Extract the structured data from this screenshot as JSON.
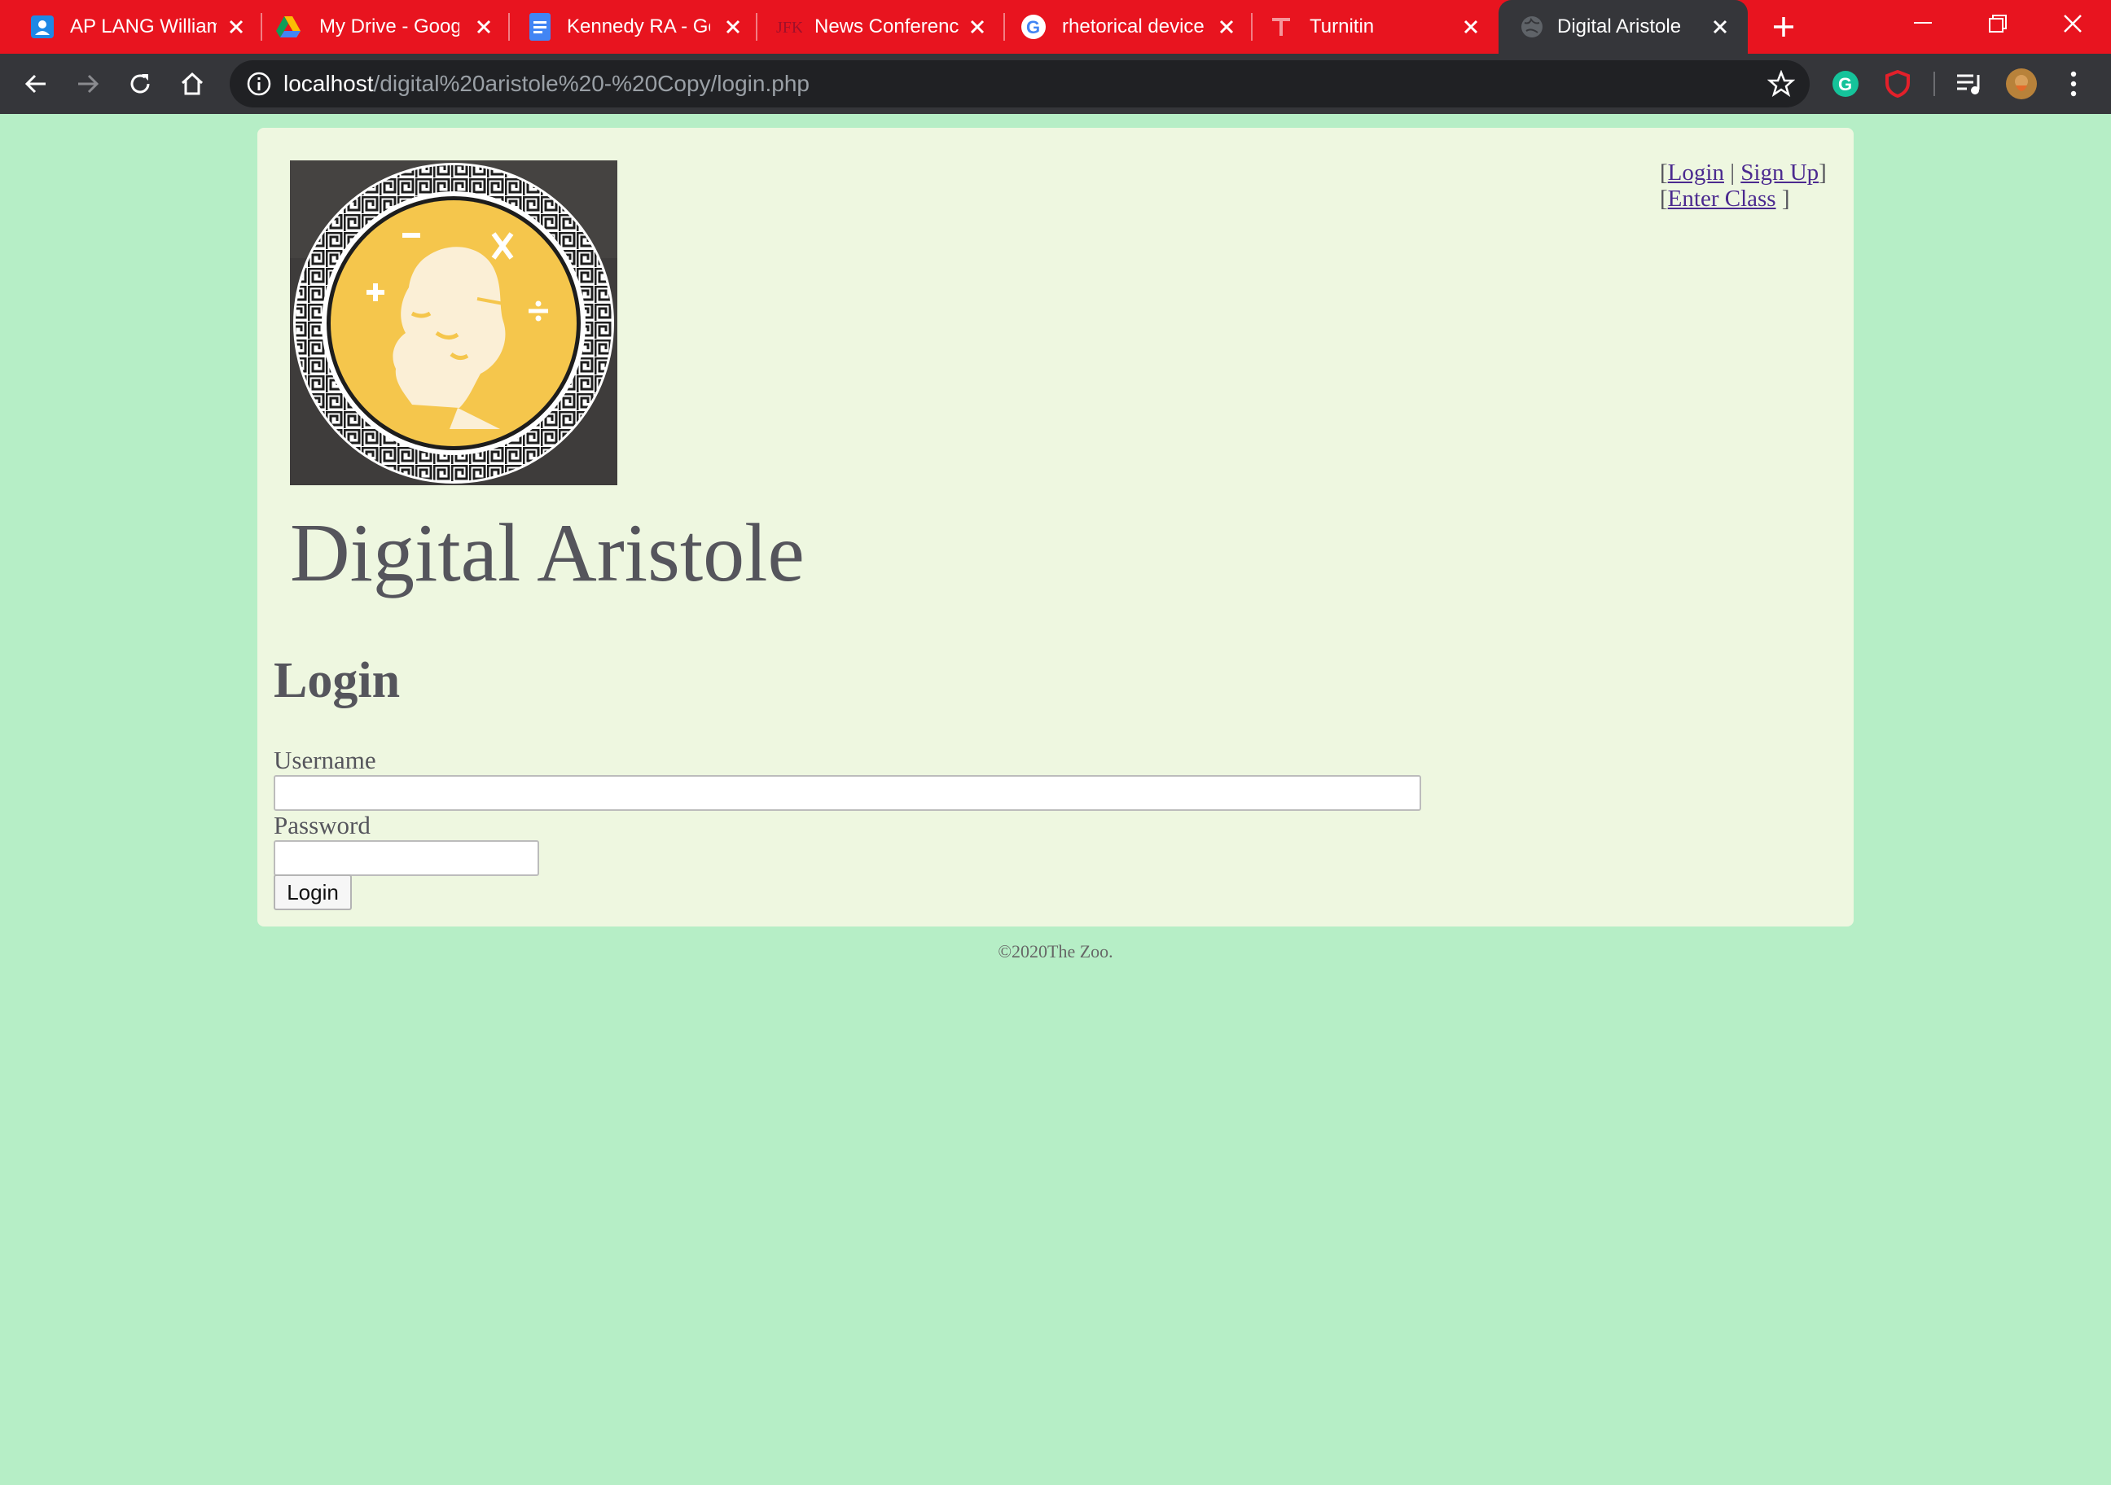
{
  "browser": {
    "tabs": [
      {
        "title": "AP LANG William",
        "favicon": "classroom-icon"
      },
      {
        "title": "My Drive - Goog",
        "favicon": "google-drive-icon"
      },
      {
        "title": "Kennedy RA - Go",
        "favicon": "google-docs-icon"
      },
      {
        "title": "News Conferenc",
        "favicon": "jfk-library-icon"
      },
      {
        "title": "rhetorical device",
        "favicon": "google-icon"
      },
      {
        "title": "Turnitin",
        "favicon": "turnitin-icon"
      },
      {
        "title": "Digital Aristole",
        "favicon": "globe-icon",
        "active": true
      }
    ],
    "address": {
      "host": "localhost",
      "path": "/digital%20aristole%20-%20Copy/login.php"
    },
    "colors": {
      "tabbar": "#e8141f",
      "toolbar": "#35363a",
      "omnibox": "#202124"
    }
  },
  "page": {
    "site_title": "Digital Aristole",
    "logo_alt": "Aristotle medallion logo",
    "top_links": {
      "open1": "[",
      "login": "Login",
      "divider": " | ",
      "signup": "Sign Up",
      "close1": "]",
      "open2": "[",
      "enter_class": "Enter Class",
      "close2": " ]"
    },
    "form": {
      "heading": "Login",
      "username_label": "Username",
      "username_value": "",
      "password_label": "Password",
      "password_value": "",
      "submit_label": "Login"
    },
    "footer": "©2020The Zoo.",
    "colors": {
      "background": "#b6eec6",
      "panel": "#eef7e0",
      "text": "#55555c",
      "link": "#4b2a8f"
    }
  }
}
